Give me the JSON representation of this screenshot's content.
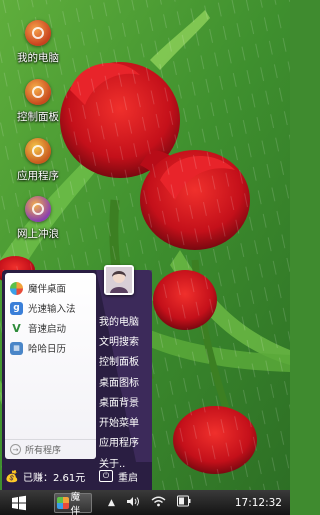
{
  "desktop": {
    "icons": [
      {
        "label": "我的电脑",
        "icon": "computer-icon",
        "color": "#d04a2a"
      },
      {
        "label": "控制面板",
        "icon": "control-panel-icon",
        "color": "#d0532a"
      },
      {
        "label": "应用程序",
        "icon": "applications-icon",
        "color": "#c8602a"
      },
      {
        "label": "网上冲浪",
        "icon": "browser-icon",
        "color": "#7a3fb0"
      }
    ]
  },
  "start_menu": {
    "left_items": [
      {
        "label": "魔伴桌面",
        "icon": "pinwheel-icon",
        "color": "#f2a23a"
      },
      {
        "label": "光速输入法",
        "icon": "input-method-icon",
        "color": "#3a7fd8"
      },
      {
        "label": "音速启动",
        "icon": "launcher-icon",
        "color": "#2e8b3a"
      },
      {
        "label": "哈哈日历",
        "icon": "calendar-icon",
        "color": "#4a86c8"
      }
    ],
    "all_programs": "所有程序",
    "right_items": [
      "我的电脑",
      "文明搜索",
      "控制面板",
      "桌面图标",
      "桌面背景",
      "开始菜单",
      "应用程序",
      "关于.."
    ],
    "earned": "已赚：2.61元",
    "restart": "重启"
  },
  "taskbar": {
    "app_label": "魔伴",
    "tray_arrow": "▲",
    "time": "17:12:32"
  }
}
